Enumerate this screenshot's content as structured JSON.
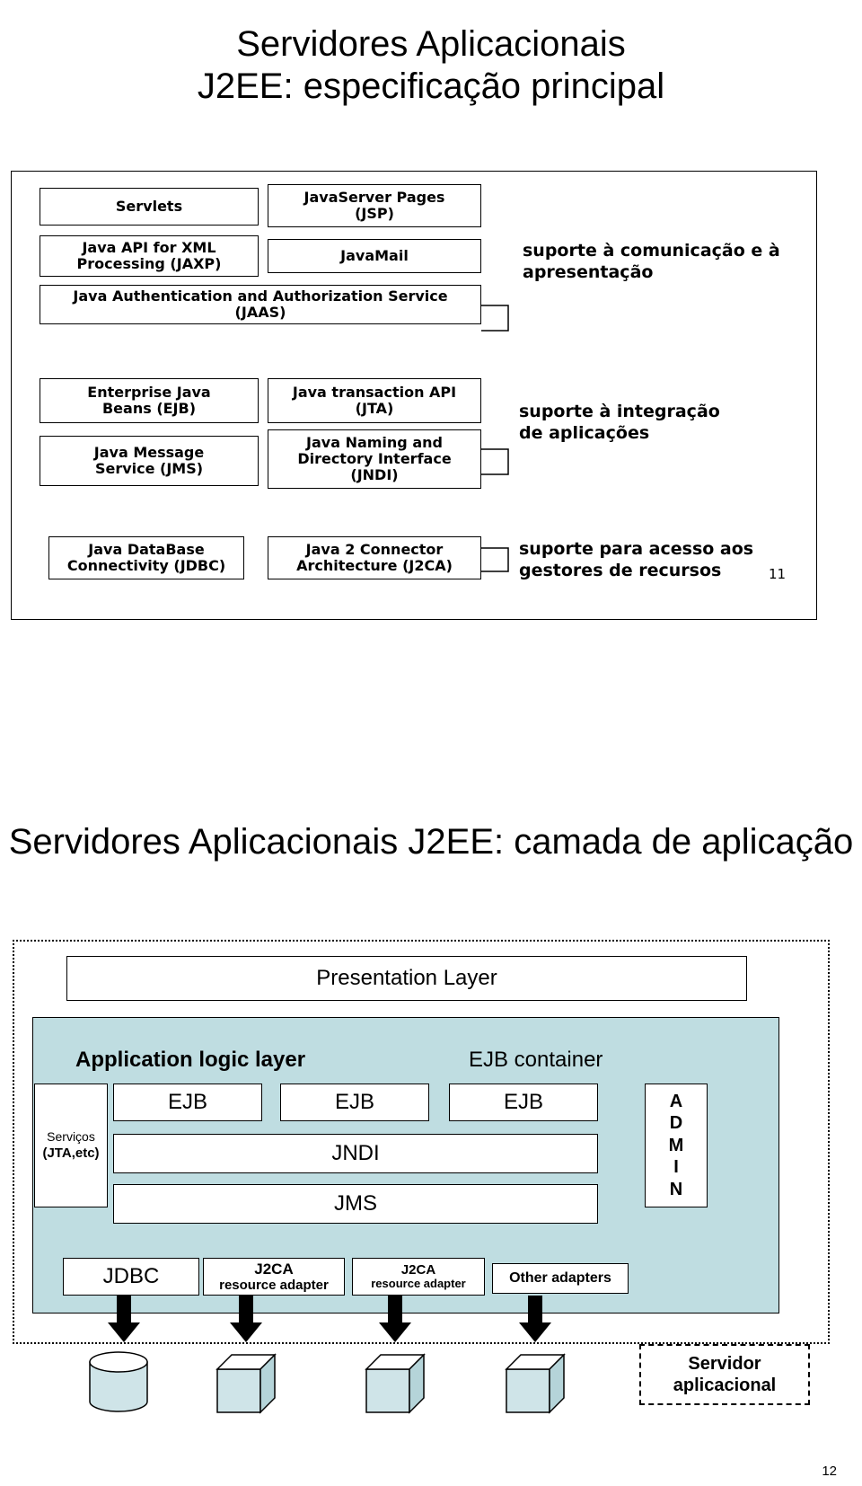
{
  "slide11": {
    "title_line1": "Servidores Aplicacionais",
    "title_line2": "J2EE: especificação principal",
    "page_number": "11",
    "tier1": {
      "boxes": [
        {
          "label": "Servlets"
        },
        {
          "label": "JavaServer Pages\n(JSP)"
        },
        {
          "label": "Java API for XML\nProcessing (JAXP)"
        },
        {
          "label": "JavaMail"
        },
        {
          "label": "Java Authentication and Authorization Service\n(JAAS)"
        }
      ],
      "side_text": "suporte à comunicação e à\napresentação"
    },
    "tier2": {
      "boxes": [
        {
          "label": "Enterprise Java\nBeans (EJB)"
        },
        {
          "label": "Java transaction API\n(JTA)"
        },
        {
          "label": "Java Message\nService (JMS)"
        },
        {
          "label": "Java Naming and\nDirectory Interface\n(JNDI)"
        }
      ],
      "side_text": "suporte à integração\nde aplicações"
    },
    "tier3": {
      "boxes": [
        {
          "label": "Java DataBase\nConnectivity (JDBC)"
        },
        {
          "label": "Java 2 Connector\nArchitecture (J2CA)"
        }
      ],
      "side_text": "suporte para acesso aos\ngestores de recursos"
    }
  },
  "slide12": {
    "title_line1": "Servidores Aplicacionais",
    "title_line2": "J2EE: camada de aplicação",
    "page_number": "12",
    "presentation_layer": "Presentation Layer",
    "application_logic_label": "Application logic layer",
    "ejb_container_label": "EJB container",
    "servicos": {
      "line1": "Serviços",
      "line2": "(JTA,etc)"
    },
    "ejb_boxes": [
      "EJB",
      "EJB",
      "EJB"
    ],
    "jndi_label": "JNDI",
    "jms_label": "JMS",
    "admin_letters": [
      "A",
      "D",
      "M",
      "I",
      "N"
    ],
    "jdbc_label": "JDBC",
    "adapters": [
      {
        "line1": "J2CA",
        "line2": "resource adapter"
      },
      {
        "line1": "J2CA",
        "line2": "resource adapter"
      },
      {
        "line1": "Other adapters",
        "line2": ""
      }
    ],
    "servidor_box": "Servidor\naplicacional"
  },
  "colors": {
    "panel_blue": "#bfdde1",
    "cylinder_fill": "#cfe4e8",
    "outline": "#000000"
  }
}
